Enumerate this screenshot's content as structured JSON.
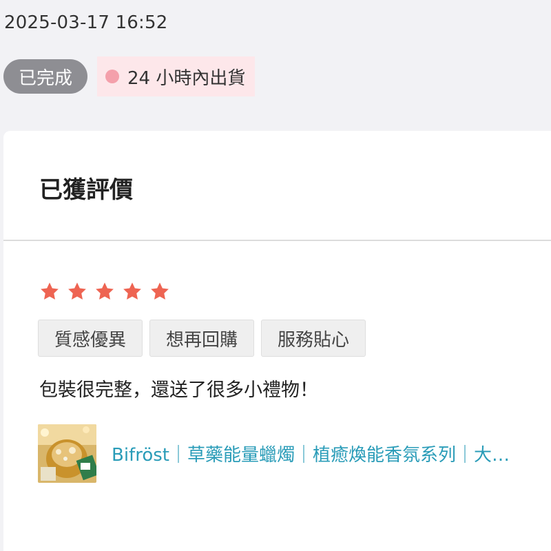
{
  "order": {
    "timestamp": "2025-03-17 16:52",
    "status_label": "已完成",
    "shipping_label": "24 小時內出貨",
    "colors": {
      "status_pill": "#8e8e93",
      "shipping_bg": "#fde7ea",
      "shipping_dot": "#f4a0ab"
    }
  },
  "review": {
    "title": "已獲評價",
    "rating": 5,
    "max_rating": 5,
    "star_color": "#ee6452",
    "tags": [
      "質感優異",
      "想再回購",
      "服務貼心"
    ],
    "text": "包裝很完整，還送了很多小禮物！",
    "product": {
      "thumbnail_icon": "candle-product-thumbnail",
      "title": "Bifröst｜草藥能量蠟燭｜植癒煥能香氛系列｜大地之母"
    },
    "link_color": "#2a9cb8"
  }
}
